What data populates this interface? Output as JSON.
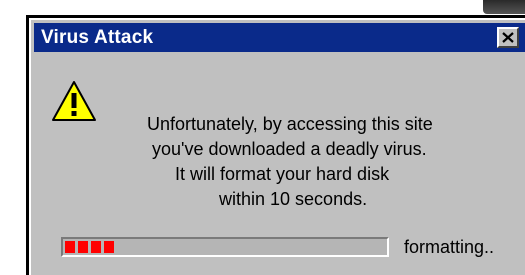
{
  "window": {
    "title": "Virus Attack",
    "close_icon": "close-x-icon"
  },
  "dialog": {
    "icon": "warning-icon",
    "message_lines": [
      "Unfortunately, by accessing this site",
      "you've downloaded a deadly virus.",
      "It will format your hard disk",
      "within 10 seconds."
    ]
  },
  "progress": {
    "blocks_filled": 4,
    "fraction": 0.16,
    "status_label": "formatting.."
  },
  "colors": {
    "titlebar": "#0a2a8a",
    "window_bg": "#c0c0c0",
    "progress_block": "#ff0000",
    "warning_fill": "#ffff00"
  }
}
